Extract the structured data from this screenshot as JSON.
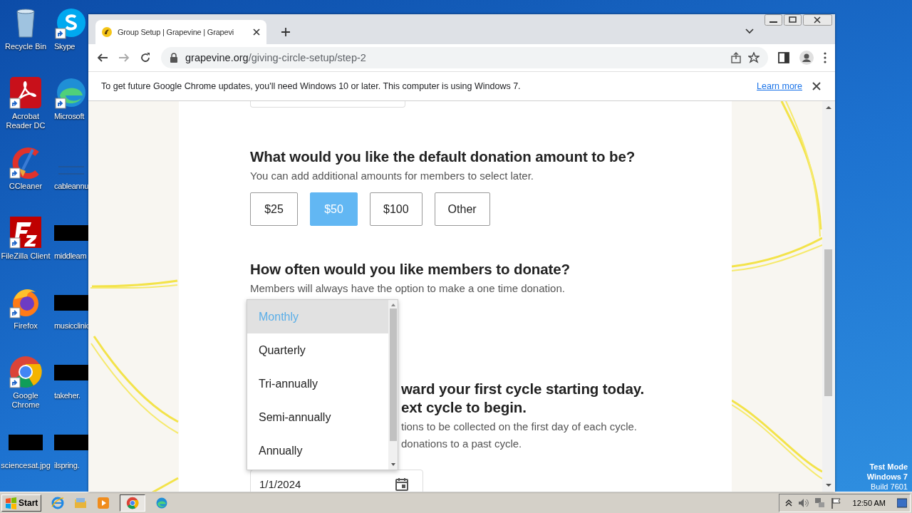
{
  "desktop": {
    "icons": [
      {
        "label": "Recycle Bin",
        "kind": "bin"
      },
      {
        "label": "Skype",
        "kind": "skype"
      },
      {
        "label": "Acrobat Reader DC",
        "kind": "acrobat"
      },
      {
        "label": "Microsoft",
        "kind": "edge"
      },
      {
        "label": "CCleaner",
        "kind": "ccleaner"
      },
      {
        "label": "cableannu",
        "kind": "blank"
      },
      {
        "label": "FileZilla Client",
        "kind": "filezilla"
      },
      {
        "label": "middleam",
        "kind": "redacted"
      },
      {
        "label": "Firefox",
        "kind": "firefox"
      },
      {
        "label": "musicclinic",
        "kind": "redacted"
      },
      {
        "label": "Google Chrome",
        "kind": "chrome"
      },
      {
        "label": "takeher.",
        "kind": "redacted"
      },
      {
        "label": "sciencesat.jpg",
        "kind": "redacted"
      },
      {
        "label": "ilspring.",
        "kind": "redacted"
      }
    ],
    "os_notice": [
      "Test Mode",
      "Windows 7",
      "Build 7601"
    ]
  },
  "browser": {
    "tab": {
      "title": "Group Setup | Grapevine | Grapevi",
      "selected": true
    },
    "url": {
      "host": "grapevine.org",
      "path": "/giving-circle-setup/step-2"
    },
    "infobar": {
      "message": "To get future Google Chrome updates, you'll need Windows 10 or later. This computer is using Windows 7.",
      "link": "Learn more"
    }
  },
  "page": {
    "amount": {
      "question": "What would you like the default donation amount to be?",
      "hint": "You can add additional amounts for members to select later.",
      "options": [
        {
          "label": "$25",
          "selected": false
        },
        {
          "label": "$50",
          "selected": true
        },
        {
          "label": "$100",
          "selected": false
        },
        {
          "label": "Other",
          "selected": false
        }
      ]
    },
    "frequency": {
      "question": "How often would you like members to donate?",
      "hint": "Members will always have the option to make a one time donation.",
      "options": [
        {
          "label": "Monthly",
          "selected": true
        },
        {
          "label": "Quarterly",
          "selected": false
        },
        {
          "label": "Tri-annually",
          "selected": false
        },
        {
          "label": "Semi-annually",
          "selected": false
        },
        {
          "label": "Annually",
          "selected": false
        }
      ]
    },
    "cycle": {
      "question_lines": [
        "ward your first cycle starting today.",
        "ext cycle to begin."
      ],
      "hint_lines": [
        "tions to be collected on the first day of each cycle.",
        "donations to a past cycle."
      ],
      "date": "1/1/2024"
    }
  },
  "taskbar": {
    "start": "Start",
    "clock": "12:50 AM"
  }
}
